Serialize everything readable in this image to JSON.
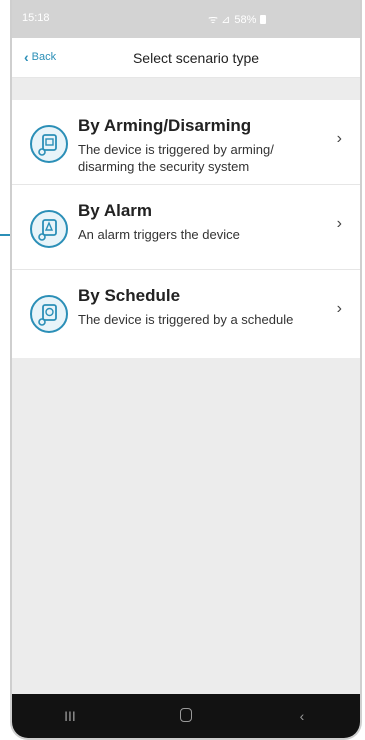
{
  "status_bar": {
    "time": "15:18",
    "signal": "ᯤ ⊿",
    "battery_pct": "58%"
  },
  "header": {
    "back_label": "Back",
    "title": "Select scenario type"
  },
  "scenarios": [
    {
      "title": "By Arming/Disarming",
      "description": "The device is triggered by arming/ disarming the security system",
      "icon": "arming-device-icon"
    },
    {
      "title": "By Alarm",
      "description": "An alarm triggers the device",
      "icon": "alarm-device-icon"
    },
    {
      "title": "By Schedule",
      "description": "The device is triggered by a schedule",
      "icon": "schedule-device-icon"
    }
  ],
  "nav": {
    "recents": "III",
    "back": "‹"
  },
  "colors": {
    "accent": "#2b8fb7",
    "background": "#ececec",
    "nav_bar": "#121212"
  }
}
